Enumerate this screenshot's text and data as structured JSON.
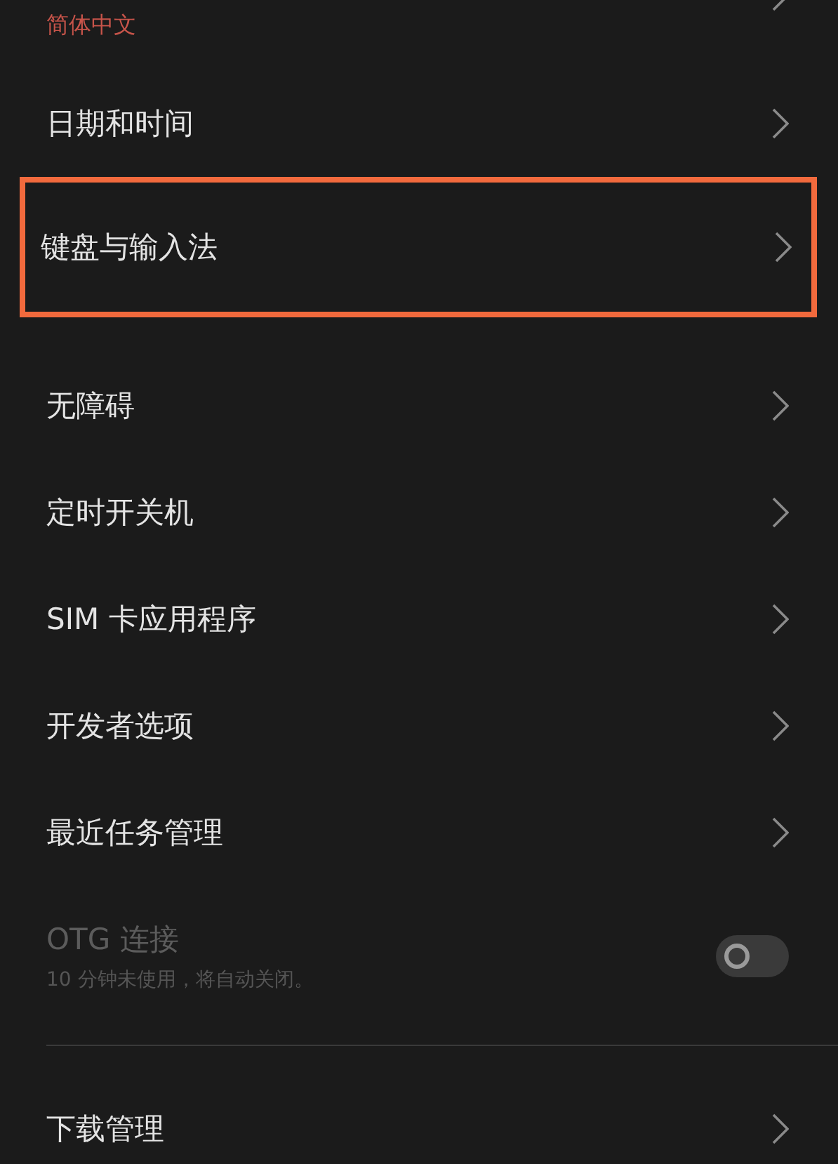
{
  "settings": {
    "items": [
      {
        "kind": "link",
        "value": "简体中文",
        "highlighted": false
      },
      {
        "kind": "link",
        "title": "日期和时间",
        "highlighted": false
      },
      {
        "kind": "link",
        "title": "键盘与输入法",
        "highlighted": true
      },
      {
        "kind": "link",
        "title": "无障碍",
        "highlighted": false
      },
      {
        "kind": "link",
        "title": "定时开关机",
        "highlighted": false
      },
      {
        "kind": "link",
        "title": "SIM 卡应用程序",
        "highlighted": false
      },
      {
        "kind": "link",
        "title": "开发者选项",
        "highlighted": false
      },
      {
        "kind": "link",
        "title": "最近任务管理",
        "highlighted": false
      },
      {
        "kind": "toggle",
        "title": "OTG 连接",
        "subtitle": "10 分钟未使用，将自动关闭。",
        "on": false,
        "disabled": true,
        "highlighted": false
      },
      {
        "kind": "divider"
      },
      {
        "kind": "link",
        "title": "下载管理",
        "highlighted": false
      }
    ]
  }
}
